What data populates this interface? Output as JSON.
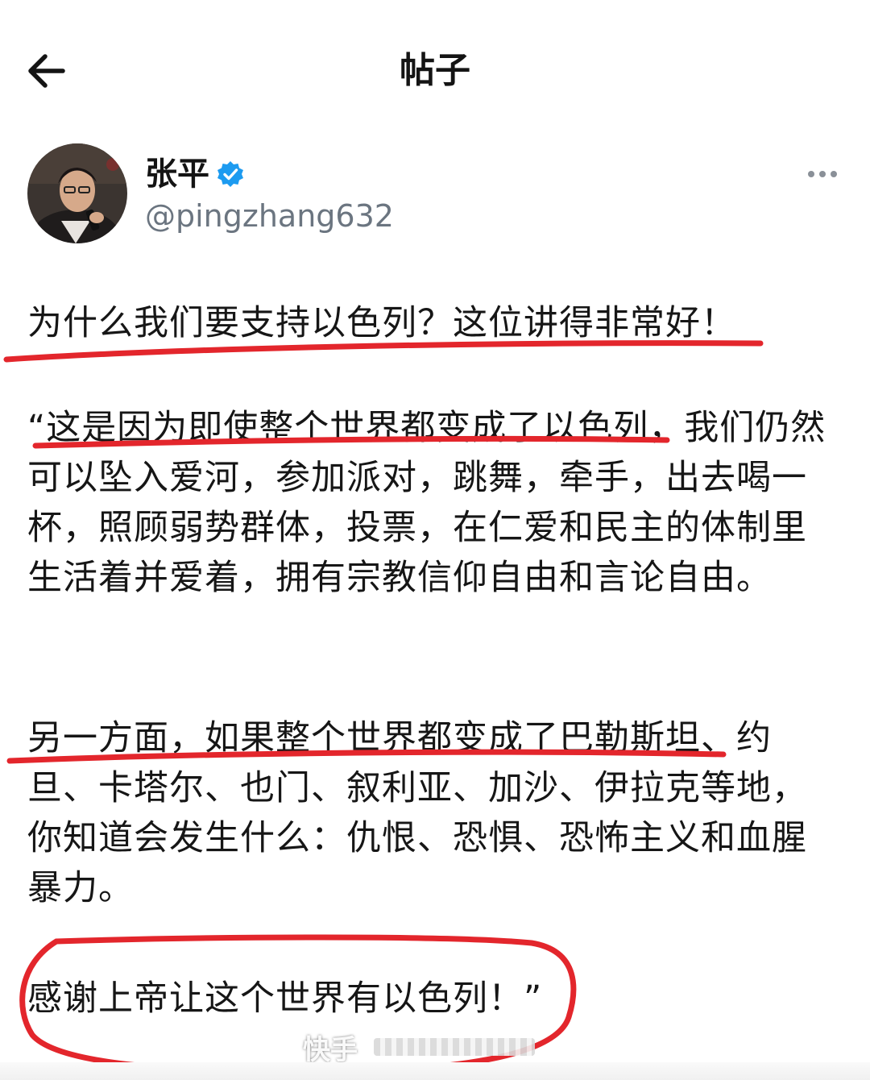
{
  "header": {
    "title": "帖子",
    "back_icon": "arrow-left-icon"
  },
  "post": {
    "author": {
      "name": "张平",
      "handle": "@pingzhang632",
      "verified_icon": "verified-badge-icon",
      "verified_color": "#1d9bf0"
    },
    "more_icon": "more-dots-icon",
    "paragraphs": [
      "为什么我们要支持以色列？这位讲得非常好！",
      "“这是因为即使整个世界都变成了以色列，我们仍然可以坠入爱河，参加派对，跳舞，牵手，出去喝一杯，照顾弱势群体，投票，在仁爱和民主的体制里生活着并爱着，拥有宗教信仰自由和言论自由。",
      "另一方面，如果整个世界都变成了巴勒斯坦、约旦、卡塔尔、也门、叙利亚、加沙、伊拉克等地，你知道会发生什么：仇恨、恐惧、恐怖主义和血腥暴力。",
      "感谢上帝让这个世界有以色列！”"
    ]
  },
  "annotations": {
    "ink_color": "#e3262c"
  },
  "watermark": {
    "text": "快手"
  }
}
